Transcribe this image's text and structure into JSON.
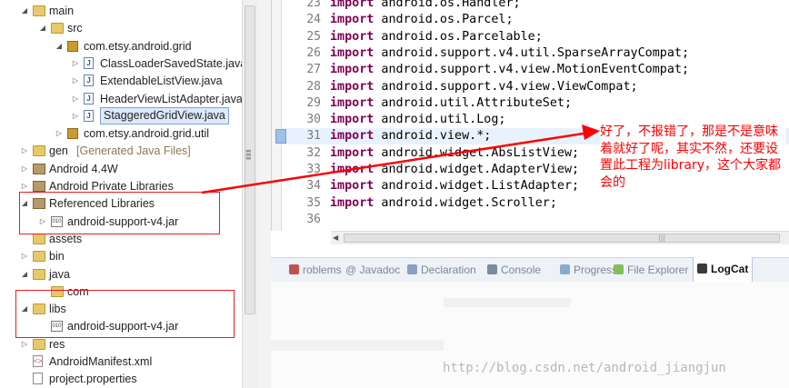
{
  "tree": {
    "items": [
      {
        "label": "main",
        "indent": 0,
        "toggle": "▲",
        "icon": "folder"
      },
      {
        "label": "src",
        "indent": 1,
        "toggle": "▲",
        "icon": "folder"
      },
      {
        "label": "com.etsy.android.grid",
        "indent": 2,
        "toggle": "▲",
        "icon": "pkg"
      },
      {
        "label": "ClassLoaderSavedState.java",
        "indent": 3,
        "toggle": "▷",
        "icon": "jfile"
      },
      {
        "label": "ExtendableListView.java",
        "indent": 3,
        "toggle": "▷",
        "icon": "jfile"
      },
      {
        "label": "HeaderViewListAdapter.java",
        "indent": 3,
        "toggle": "▷",
        "icon": "jfile"
      },
      {
        "label": "StaggeredGridView.java",
        "indent": 3,
        "toggle": "▷",
        "icon": "jfile",
        "selected": true
      },
      {
        "label": "com.etsy.android.grid.util",
        "indent": 2,
        "toggle": "▷",
        "icon": "pkg"
      },
      {
        "label": "gen",
        "suffix": "[Generated Java Files]",
        "indent": 0,
        "toggle": "▷",
        "icon": "folder"
      },
      {
        "label": "Android 4.4W",
        "indent": 0,
        "toggle": "▷",
        "icon": "books"
      },
      {
        "label": "Android Private Libraries",
        "indent": 0,
        "toggle": "▷",
        "icon": "books"
      },
      {
        "label": "Referenced Libraries",
        "indent": 0,
        "toggle": "▲",
        "icon": "books"
      },
      {
        "label": "android-support-v4.jar",
        "indent": 1,
        "toggle": "▷",
        "icon": "jar"
      },
      {
        "label": "assets",
        "indent": 0,
        "toggle": "",
        "icon": "folder"
      },
      {
        "label": "bin",
        "indent": 0,
        "toggle": "▷",
        "icon": "folder"
      },
      {
        "label": "java",
        "indent": 0,
        "toggle": "▲",
        "icon": "folder"
      },
      {
        "label": "com",
        "indent": 1,
        "toggle": "",
        "icon": "folder"
      },
      {
        "label": "libs",
        "indent": 0,
        "toggle": "▲",
        "icon": "folder"
      },
      {
        "label": "android-support-v4.jar",
        "indent": 1,
        "toggle": "",
        "icon": "jar"
      },
      {
        "label": "res",
        "indent": 0,
        "toggle": "▷",
        "icon": "folder"
      },
      {
        "label": "AndroidManifest.xml",
        "indent": 0,
        "toggle": "",
        "icon": "xml"
      },
      {
        "label": "project.properties",
        "indent": 0,
        "toggle": "",
        "icon": "prop"
      }
    ]
  },
  "editor": {
    "lines": [
      {
        "num": "23",
        "kw": "import",
        "rest": " android.os.Handler;"
      },
      {
        "num": "24",
        "kw": "import",
        "rest": " android.os.Parcel;"
      },
      {
        "num": "25",
        "kw": "import",
        "rest": " android.os.Parcelable;"
      },
      {
        "num": "26",
        "kw": "import",
        "rest": " android.support.v4.util.SparseArrayCompat;"
      },
      {
        "num": "27",
        "kw": "import",
        "rest": " android.support.v4.view.MotionEventCompat;"
      },
      {
        "num": "28",
        "kw": "import",
        "rest": " android.support.v4.view.ViewCompat;"
      },
      {
        "num": "29",
        "kw": "import",
        "rest": " android.util.AttributeSet;"
      },
      {
        "num": "30",
        "kw": "import",
        "rest": " android.util.Log;"
      },
      {
        "num": "31",
        "kw": "import",
        "rest": " android.view.*;",
        "highlight": true
      },
      {
        "num": "32",
        "kw": "import",
        "rest": " android.widget.AbsListView;"
      },
      {
        "num": "33",
        "kw": "import",
        "rest": " android.widget.AdapterView;"
      },
      {
        "num": "34",
        "kw": "import",
        "rest": " android.widget.ListAdapter;"
      },
      {
        "num": "35",
        "kw": "import",
        "rest": " android.widget.Scroller;"
      },
      {
        "num": "36",
        "kw": "",
        "rest": ""
      }
    ]
  },
  "views": {
    "tabs": [
      {
        "label": "roblems",
        "icon_color": "#c05050"
      },
      {
        "label": "@ Javadoc",
        "icon_color": ""
      },
      {
        "label": "Declaration",
        "icon_color": "#8aa0c0"
      },
      {
        "label": "Console",
        "icon_color": "#7a8aa0"
      },
      {
        "label": "Progress",
        "icon_color": "#88aacc"
      },
      {
        "label": "File Explorer",
        "icon_color": "#7fbf5a"
      },
      {
        "label": "LogCat",
        "icon_color": "#3a3a3a",
        "active": true
      }
    ]
  },
  "annotation": {
    "text": "好了，不报错了，那是不是意味着就好了呢，其实不然，还要设置此工程为library，这个大家都会的",
    "color": "#ff0000"
  },
  "watermark": "http://blog.csdn.net/android_jiangjun"
}
